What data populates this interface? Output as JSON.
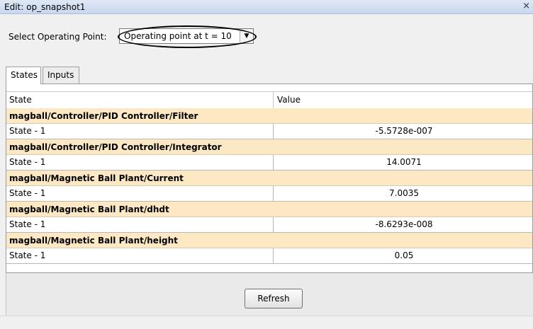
{
  "window": {
    "title": "Edit: op_snapshot1",
    "close_glyph": "×"
  },
  "operating_point": {
    "label": "Select Operating Point:",
    "selected": "Operating point at t = 10",
    "arrow_glyph": "▼"
  },
  "tabs": [
    {
      "label": "States",
      "active": true
    },
    {
      "label": "Inputs",
      "active": false
    }
  ],
  "table": {
    "columns": [
      "State",
      "Value"
    ],
    "groups": [
      {
        "name": "magball/Controller/PID Controller/Filter",
        "state": "State - 1",
        "value": "-5.5728e-007"
      },
      {
        "name": "magball/Controller/PID Controller/Integrator",
        "state": "State - 1",
        "value": "14.0071"
      },
      {
        "name": "magball/Magnetic Ball Plant/Current",
        "state": "State - 1",
        "value": "7.0035"
      },
      {
        "name": "magball/Magnetic Ball Plant/dhdt",
        "state": "State - 1",
        "value": "-8.6293e-008"
      },
      {
        "name": "magball/Magnetic Ball Plant/height",
        "state": "State - 1",
        "value": "0.05"
      }
    ]
  },
  "buttons": {
    "refresh": "Refresh"
  }
}
